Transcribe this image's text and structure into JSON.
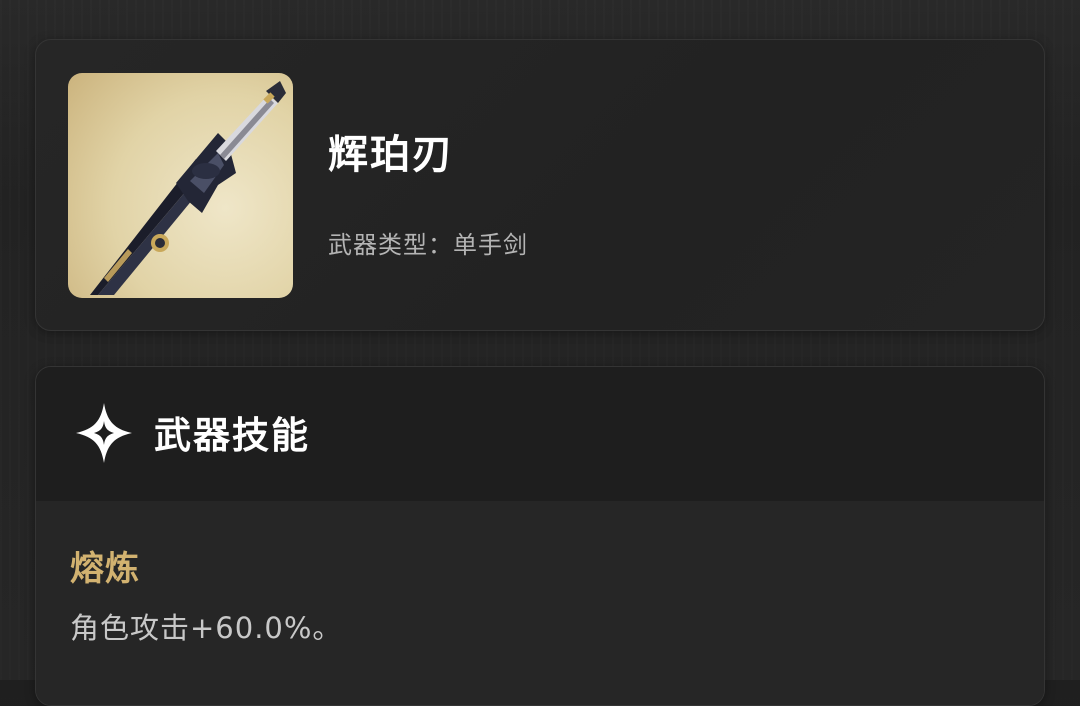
{
  "weapon": {
    "name": "辉珀刃",
    "type_label": "武器类型：",
    "type_value": "单手剑",
    "image_icon": "sword-image"
  },
  "skills_section": {
    "title": "武器技能",
    "icon": "sparkle-diamond-icon"
  },
  "skill": {
    "name": "熔炼",
    "description": "角色攻击+60.0%。"
  },
  "colors": {
    "background": "#1f1f1f",
    "card": "#232323",
    "skill_name": "#d2b270",
    "text_secondary": "#b4b4b4",
    "text_primary": "#ffffff"
  }
}
